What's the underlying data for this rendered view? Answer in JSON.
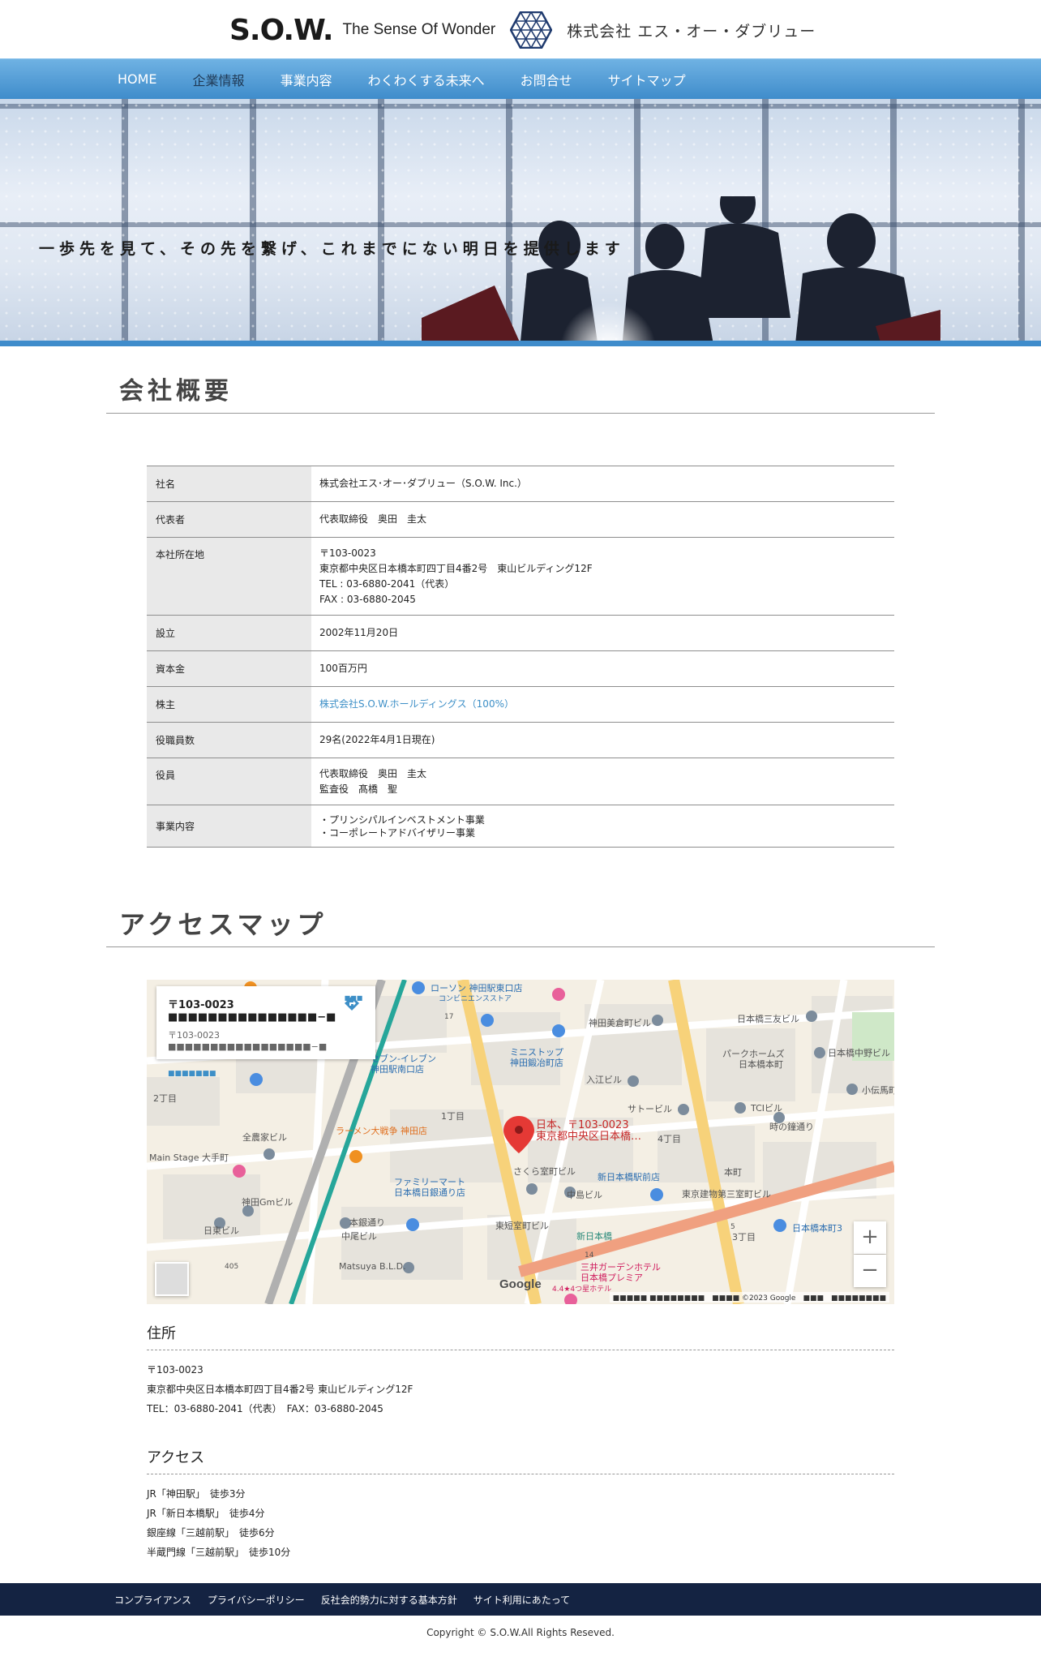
{
  "header": {
    "logo_mark": "S.O.W.",
    "logo_tagline": "The Sense Of Wonder",
    "company_jp": "株式会社 エス・オー・ダブリュー"
  },
  "nav": {
    "items": [
      {
        "label": "HOME"
      },
      {
        "label": "企業情報"
      },
      {
        "label": "事業内容"
      },
      {
        "label": "わくわくする未来へ"
      },
      {
        "label": "お問合せ"
      },
      {
        "label": "サイトマップ"
      }
    ]
  },
  "hero": {
    "tagline": "一歩先を見て、その先を繋げ、これまでにない明日を提供します"
  },
  "company": {
    "title": "会社概要",
    "rows": [
      {
        "label": "社名",
        "lines": [
          "株式会社エス･オー･ダブリュー（S.O.W. Inc.）"
        ]
      },
      {
        "label": "代表者",
        "lines": [
          "代表取締役　奥田　圭太"
        ]
      },
      {
        "label": "本社所在地",
        "lines": [
          "〒103-0023",
          "東京都中央区日本橋本町四丁目4番2号　東山ビルディング12F",
          "TEL : 03-6880-2041（代表）",
          "FAX : 03-6880-2045"
        ]
      },
      {
        "label": "設立",
        "lines": [
          "2002年11月20日"
        ]
      },
      {
        "label": "資本金",
        "lines": [
          "100百万円"
        ]
      },
      {
        "label": "株主",
        "lines": [
          "株式会社S.O.W.ホールディングス（100%）"
        ]
      },
      {
        "label": "役職員数",
        "lines": [
          "29名(2022年4月1日現在)"
        ]
      },
      {
        "label": "役員",
        "lines": [
          "代表取締役　奥田　圭太",
          "監査役　髙橋　聖"
        ]
      },
      {
        "label": "事業内容",
        "lines": [
          "・プリンシパルインベストメント事業",
          "・コーポレートアドバイザリー事業"
        ]
      }
    ]
  },
  "access_map": {
    "title": "アクセスマップ",
    "card_title": "〒103-0023 ■■■■■■■■■■■■■■■−■",
    "card_sub": "〒103-0023 ■■■■■■■■■■■■■■■■■−■",
    "card_link": "■■■■■■■",
    "directions_label": "■■■",
    "pin_label_1": "日本、〒103-0023",
    "pin_label_2": "東京都中央区日本橋…",
    "zoom_in": "+",
    "zoom_out": "−",
    "google": "Google",
    "footer": "■■■■■ ■■■■■■■■　■■■■ ©2023 Google　■■■　■■■■■■■■",
    "labels": [
      "ローソン 神田駅東口店",
      "コンビニエンスストア",
      "神田美倉町ビル",
      "日本橋三友ビル",
      "ミニストップ",
      "神田鍛冶町店",
      "セブン-イレブン",
      "神田駅南口店",
      "入江ビル",
      "パークホームズ",
      "日本橋本町",
      "日本橋中野ビル",
      "小伝馬町",
      "サトービル",
      "TCIビル",
      "時の鐘通り",
      "1丁目",
      "4丁目",
      "2丁目",
      "全農家ビル",
      "ラーメン大戦争 神田店",
      "Main Stage 大手町",
      "ファミリーマート",
      "日本橋日銀通り店",
      "さくら室町ビル",
      "中島ビル",
      "新日本橋駅前店",
      "東京建物第三室町ビル",
      "神田Gmビル",
      "日東ビル",
      "中尾ビル",
      "本銀通り",
      "東短室町ビル",
      "新日本橋",
      "日本橋本町3",
      "3丁目",
      "三井ガーデンホテル",
      "日本橋プレミア",
      "4.4★4つ星ホテル",
      "Matsuya B.L.D.",
      "本町",
      "405",
      "17",
      "14",
      "5"
    ]
  },
  "address": {
    "heading": "住所",
    "lines": [
      "〒103-0023",
      "東京都中央区日本橋本町四丁目4番2号 東山ビルディング12F",
      "TEL：03-6880-2041（代表）　FAX：03-6880-2045"
    ]
  },
  "access": {
    "heading": "アクセス",
    "lines": [
      "JR「神田駅」　徒歩3分",
      "JR「新日本橋駅」　徒歩4分",
      "銀座線「三越前駅」　徒歩6分",
      "半蔵門線「三越前駅」　徒歩10分"
    ]
  },
  "footer": {
    "links": [
      {
        "label": "コンプライアンス"
      },
      {
        "label": "プライバシーポリシー"
      },
      {
        "label": "反社会的勢力に対する基本方針"
      },
      {
        "label": "サイト利用にあたって"
      }
    ],
    "copyright": "Copyright © S.O.W.All Rights Reseved."
  },
  "colors": {
    "nav_gradient_top": "#6fb2e3",
    "nav_gradient_bottom": "#3f8ccb",
    "nav_active": "#203a56",
    "footer_bg": "#142342",
    "link": "#3d8fc7",
    "map_pin": "#e53935"
  }
}
